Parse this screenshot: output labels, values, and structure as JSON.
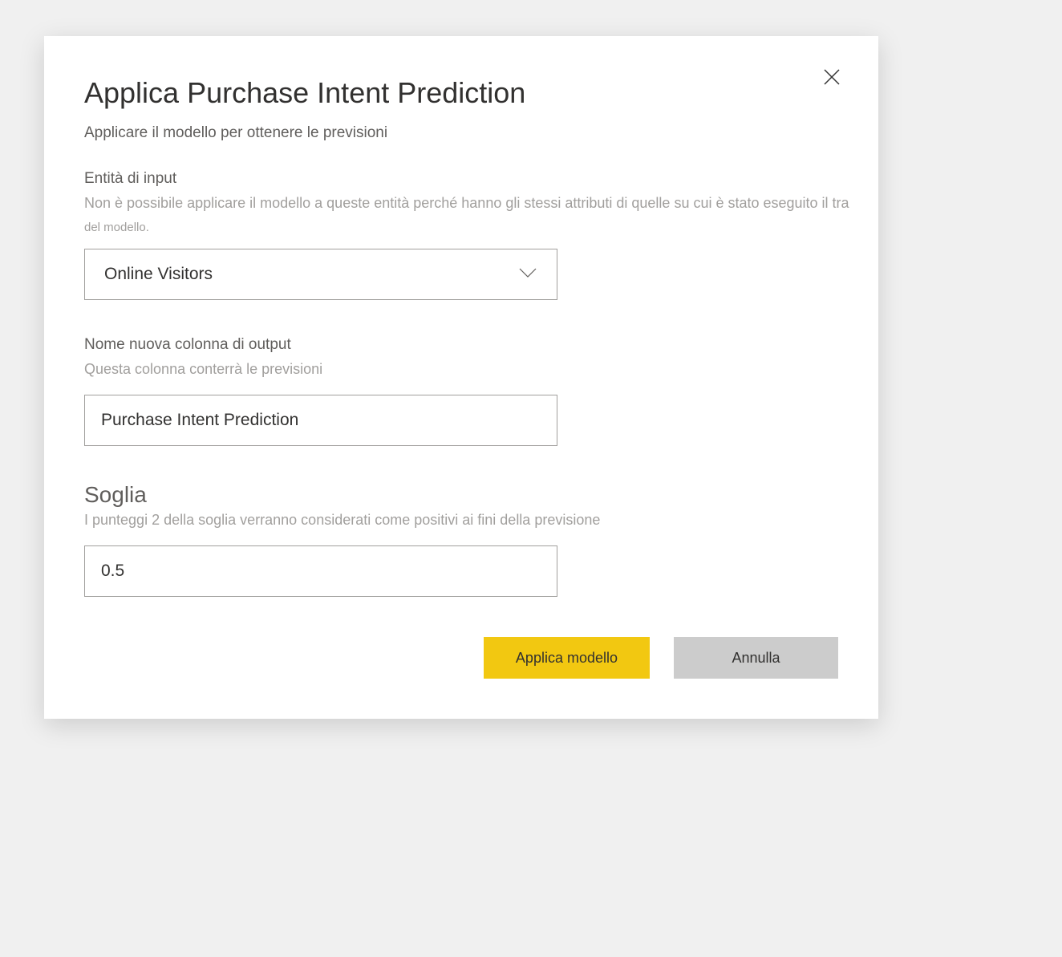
{
  "dialog": {
    "title": "Applica Purchase Intent Prediction",
    "subtitle": "Applicare il modello per ottenere le previsioni"
  },
  "entity": {
    "label": "Entità di input",
    "help1": "Non è possibile applicare il modello a queste entità perché hanno gli stessi attributi di quelle su cui è stato eseguito il tra",
    "help2": "del modello.",
    "value": "Online Visitors"
  },
  "output": {
    "label": "Nome nuova colonna di output",
    "help": "Questa colonna conterrà le previsioni",
    "value": "Purchase Intent Prediction"
  },
  "threshold": {
    "title": "Soglia",
    "help": "I punteggi 2 della soglia verranno considerati come positivi ai fini della previsione",
    "value": "0.5"
  },
  "buttons": {
    "apply": "Applica modello",
    "cancel": "Annulla"
  }
}
